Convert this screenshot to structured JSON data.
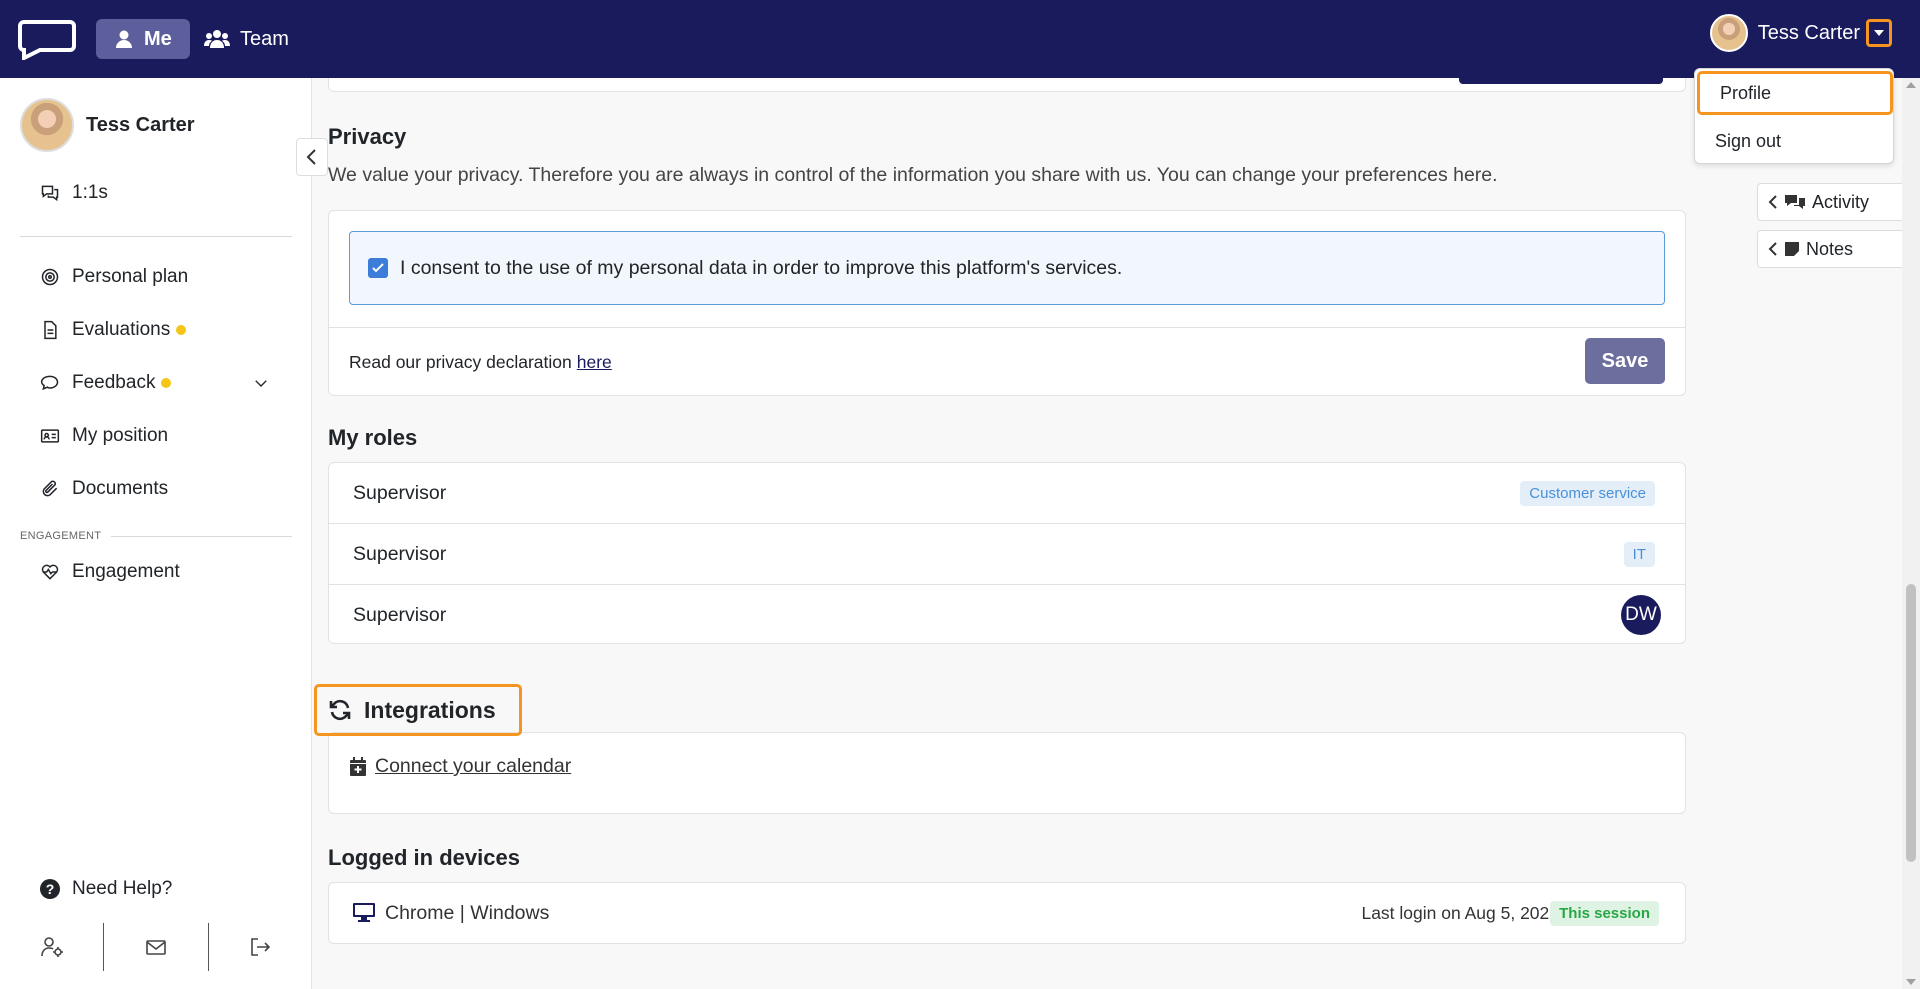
{
  "topbar": {
    "nav": [
      {
        "label": "Me",
        "icon": "user-icon"
      },
      {
        "label": "Team",
        "icon": "users-icon"
      }
    ],
    "user_name": "Tess Carter",
    "dropdown": [
      "Profile",
      "Sign out"
    ]
  },
  "sidebar": {
    "user_name": "Tess Carter",
    "top_item": "1:1s",
    "items": [
      "Personal plan",
      "Evaluations",
      "Feedback",
      "My position",
      "Documents"
    ],
    "section_label": "ENGAGEMENT",
    "engagement_item": "Engagement",
    "help": "Need Help?"
  },
  "right_rail": [
    "Activity",
    "Notes"
  ],
  "privacy": {
    "title": "Privacy",
    "description": "We value your privacy. Therefore you are always in control of the information you share with us. You can change your preferences here.",
    "consent": "I consent to the use of my personal data in order to improve this platform's services.",
    "declaration_prefix": "Read our privacy declaration",
    "declaration_link": "here",
    "save": "Save"
  },
  "roles": {
    "title": "My roles",
    "items": [
      {
        "role": "Supervisor",
        "tag": "Customer service"
      },
      {
        "role": "Supervisor",
        "tag": "IT"
      },
      {
        "role": "Supervisor",
        "initials": "DW"
      }
    ]
  },
  "integrations": {
    "title": "Integrations",
    "link": " Connect your calendar"
  },
  "devices": {
    "title": "Logged in devices",
    "device": "Chrome | Windows",
    "last_login": "Last login on Aug 5, 2026",
    "session_tag": "This session"
  },
  "colors": {
    "topbar": "#1a1b5c",
    "accent_highlight": "#f5951f",
    "notification_dot": "#f5c518"
  }
}
